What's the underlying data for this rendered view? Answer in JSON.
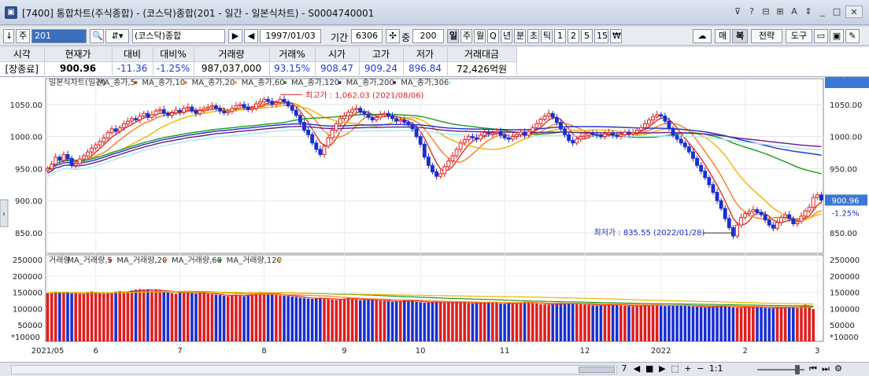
{
  "window": {
    "title": "[7400] 통합차트(주식종합) - (코스닥)종합(201 - 일간 - 일본식차트) - S0004740001",
    "icon": "app-icon",
    "controls": [
      "⊽",
      "?",
      "⊟",
      "⊞",
      "A",
      "⇕",
      "_",
      "□",
      "✕"
    ]
  },
  "toolbar": {
    "code_value": "201",
    "stock_name": "(코스닥)종합",
    "date_value": "1997/01/03",
    "period_label": "기간",
    "period_value": "6306",
    "unit_label": "중",
    "unit_value": "200",
    "period_tabs": [
      "일",
      "주",
      "월",
      "Q",
      "년",
      "분",
      "초",
      "틱",
      "1",
      "2",
      "5",
      "15",
      "₩"
    ],
    "selected_period": "일",
    "right_buttons": [
      "매",
      "복",
      "전략",
      "도구"
    ],
    "jump_label": "주"
  },
  "quote": {
    "headers": [
      "시각",
      "현재가",
      "대비",
      "대비%",
      "거래량",
      "거래%",
      "시가",
      "고가",
      "저가",
      "거래대금"
    ],
    "values": [
      "[장종료]",
      "900.96",
      "-11.36",
      "-1.25%",
      "987,037,000",
      "93.15%",
      "908.47",
      "909.24",
      "896.84",
      "72,426억원"
    ],
    "colors": [
      "#000000",
      "#000000",
      "#1a3fd0",
      "#1a3fd0",
      "#000000",
      "#1a3fd0",
      "#1a3fd0",
      "#1a3fd0",
      "#1a3fd0",
      "#000000"
    ]
  },
  "chart_data": {
    "type": "candlestick",
    "price_legend": [
      {
        "name": "일본식차트(일간)",
        "color": "#333333"
      },
      {
        "name": "MA_종가,5",
        "color": "#e0301e"
      },
      {
        "name": "MA_종가,10",
        "color": "#ff7a1a"
      },
      {
        "name": "MA_종가,20",
        "color": "#f0b400"
      },
      {
        "name": "MA_종가,60",
        "color": "#1a9a1a"
      },
      {
        "name": "MA_종가,120",
        "color": "#1a2fd0"
      },
      {
        "name": "MA_종가,200",
        "color": "#6a1a8a"
      },
      {
        "name": "MA_종가,306",
        "color": "#a8e8f8"
      }
    ],
    "volume_legend": [
      {
        "name": "거래량",
        "color": "#333333"
      },
      {
        "name": "MA_거래량,5",
        "color": "#e0301e"
      },
      {
        "name": "MA_거래량,20",
        "color": "#ff7a1a"
      },
      {
        "name": "MA_거래량,60",
        "color": "#1a9a1a"
      },
      {
        "name": "MA_거래량,120",
        "color": "#f0b400"
      }
    ],
    "price_ticks": [
      850,
      900,
      950,
      1000,
      1050
    ],
    "price_tick_labels": [
      "850.00",
      "900.00",
      "950.00",
      "1000.00",
      "1050.00"
    ],
    "price_ylim": [
      818,
      1078
    ],
    "volume_ticks": [
      50000,
      100000,
      150000,
      200000,
      250000
    ],
    "volume_tick_labels": [
      "50000",
      "100000",
      "150000",
      "200000",
      "250000"
    ],
    "volume_ylim": [
      0,
      260000
    ],
    "volume_unit": "*10000",
    "x_labels": [
      "2021/05",
      "6",
      "7",
      "8",
      "9",
      "10",
      "11",
      "12",
      "2022",
      "2",
      "3"
    ],
    "x_label_index": [
      0,
      12,
      33,
      54,
      74,
      93,
      114,
      134,
      153,
      174,
      192
    ],
    "current_price_label": "900.96",
    "current_change_label": "-1.25%",
    "current_volume_label": "987,037K",
    "current_volume_pct": "93.15%",
    "annotations": {
      "high": "최고가 : 1,062.03 (2021/08/06)",
      "low": "최저가 : 835.55 (2022/01/28)"
    },
    "highlow_index": {
      "high": 58,
      "low": 172
    },
    "closes": [
      950,
      957,
      968,
      963,
      972,
      966,
      955,
      958,
      965,
      970,
      976,
      982,
      987,
      992,
      998,
      1006,
      1012,
      1008,
      1014,
      1020,
      1024,
      1028,
      1026,
      1032,
      1036,
      1030,
      1034,
      1040,
      1042,
      1036,
      1033,
      1037,
      1041,
      1038,
      1044,
      1046,
      1040,
      1036,
      1041,
      1044,
      1046,
      1048,
      1044,
      1040,
      1037,
      1039,
      1044,
      1048,
      1050,
      1046,
      1042,
      1044,
      1051,
      1054,
      1058,
      1055,
      1050,
      1053,
      1058,
      1054,
      1048,
      1041,
      1033,
      1022,
      1010,
      1003,
      990,
      980,
      972,
      985,
      998,
      1010,
      1020,
      1028,
      1032,
      1038,
      1042,
      1044,
      1038,
      1035,
      1030,
      1026,
      1030,
      1034,
      1036,
      1032,
      1028,
      1024,
      1026,
      1022,
      1018,
      1012,
      1000,
      988,
      968,
      955,
      945,
      938,
      942,
      953,
      962,
      970,
      980,
      990,
      995,
      1000,
      998,
      996,
      1002,
      1006,
      1004,
      1006,
      1008,
      1002,
      998,
      996,
      1000,
      1003,
      1007,
      1002,
      1008,
      1014,
      1020,
      1027,
      1032,
      1036,
      1030,
      1022,
      1012,
      1003,
      994,
      990,
      996,
      1000,
      1002,
      1005,
      1003,
      1002,
      1000,
      1004,
      1006,
      1002,
      1000,
      1003,
      1007,
      1004,
      1006,
      1010,
      1014,
      1020,
      1026,
      1031,
      1034,
      1032,
      1024,
      1013,
      1002,
      996,
      990,
      984,
      976,
      966,
      955,
      946,
      936,
      925,
      913,
      900,
      888,
      872,
      858,
      845,
      862,
      874,
      880,
      883,
      886,
      882,
      878,
      870,
      862,
      857,
      866,
      874,
      878,
      872,
      864,
      868,
      876,
      884,
      890,
      905,
      909,
      900.96
    ],
    "volumes": [
      148000,
      150000,
      152000,
      151000,
      149000,
      150000,
      147000,
      148000,
      146000,
      145000,
      151000,
      153000,
      149000,
      147000,
      146000,
      148000,
      150000,
      152000,
      154000,
      151000,
      150000,
      156000,
      158000,
      160000,
      159000,
      157000,
      155000,
      158000,
      156000,
      154000,
      150000,
      148000,
      146000,
      151000,
      153000,
      149000,
      147000,
      146000,
      148000,
      150000,
      145000,
      144000,
      143000,
      142000,
      140000,
      139000,
      141000,
      143000,
      140000,
      138000,
      142000,
      145000,
      147000,
      151000,
      149000,
      146000,
      144000,
      142000,
      141000,
      140000,
      139000,
      137000,
      136000,
      134000,
      133000,
      131000,
      130000,
      132000,
      134000,
      131000,
      129000,
      128000,
      127000,
      129000,
      131000,
      133000,
      130000,
      128000,
      126000,
      127000,
      129000,
      128000,
      126000,
      125000,
      124000,
      123000,
      121000,
      122000,
      124000,
      126000,
      125000,
      123000,
      121000,
      120000,
      118000,
      119000,
      121000,
      122000,
      120000,
      118000,
      119000,
      120000,
      121000,
      119000,
      118000,
      117000,
      116000,
      118000,
      119000,
      120000,
      121000,
      119000,
      118000,
      116000,
      115000,
      116000,
      118000,
      119000,
      120000,
      121000,
      119000,
      117000,
      116000,
      114000,
      113000,
      112000,
      114000,
      115000,
      116000,
      117000,
      118000,
      116000,
      115000,
      114000,
      113000,
      112000,
      110000,
      109000,
      111000,
      112000,
      113000,
      114000,
      112000,
      110000,
      109000,
      108000,
      107000,
      108000,
      110000,
      111000,
      112000,
      113000,
      111000,
      109000,
      108000,
      110000,
      112000,
      111000,
      110000,
      109000,
      108000,
      107000,
      106000,
      105000,
      104000,
      106000,
      108000,
      109000,
      110000,
      108000,
      106000,
      105000,
      104000,
      103000,
      105000,
      106000,
      107000,
      105000,
      104000,
      103000,
      102000,
      101000,
      103000,
      104000,
      105000,
      106000,
      104000,
      102000,
      108000,
      112000,
      110000,
      98703
    ]
  }
}
